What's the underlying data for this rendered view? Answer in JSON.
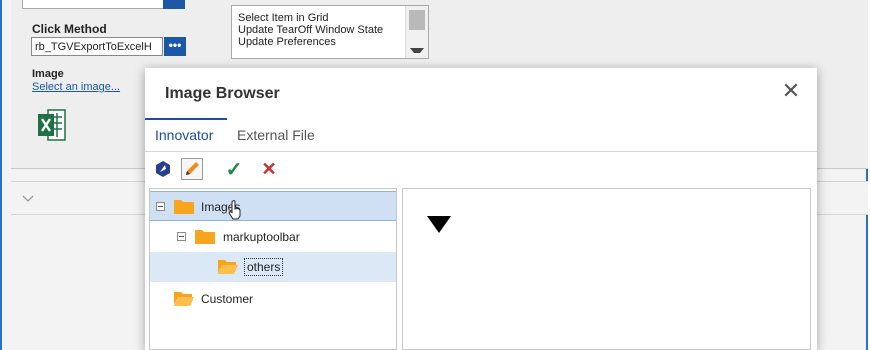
{
  "background": {
    "click_method_label": "Click Method",
    "click_method_value": "rb_TGVExportToExcelH",
    "dots_label": "•••",
    "image_label": "Image",
    "select_image_link": "Select an image...",
    "list_items": [
      "Select Item in Grid",
      "Update TearOff Window State",
      "Update Preferences"
    ]
  },
  "dialog": {
    "title": "Image Browser",
    "close_glyph": "✕",
    "tabs": [
      {
        "label": "Innovator",
        "active": true
      },
      {
        "label": "External File",
        "active": false
      }
    ],
    "toolbar": {
      "check_glyph": "✓",
      "cross_glyph": "✕"
    },
    "tree": [
      {
        "label": "Images",
        "toggle": "collapse",
        "state": "hover"
      },
      {
        "label": "markuptoolbar",
        "toggle": "collapse",
        "state": "normal"
      },
      {
        "label": "others",
        "toggle": "none",
        "state": "selected"
      },
      {
        "label": "Customer",
        "toggle": "none",
        "state": "normal"
      }
    ]
  },
  "colors": {
    "accent": "#1c4fa0",
    "folder": "#f7a51c",
    "check": "#1c8a4a",
    "cross": "#d42a2a",
    "excel": "#1e7145"
  }
}
